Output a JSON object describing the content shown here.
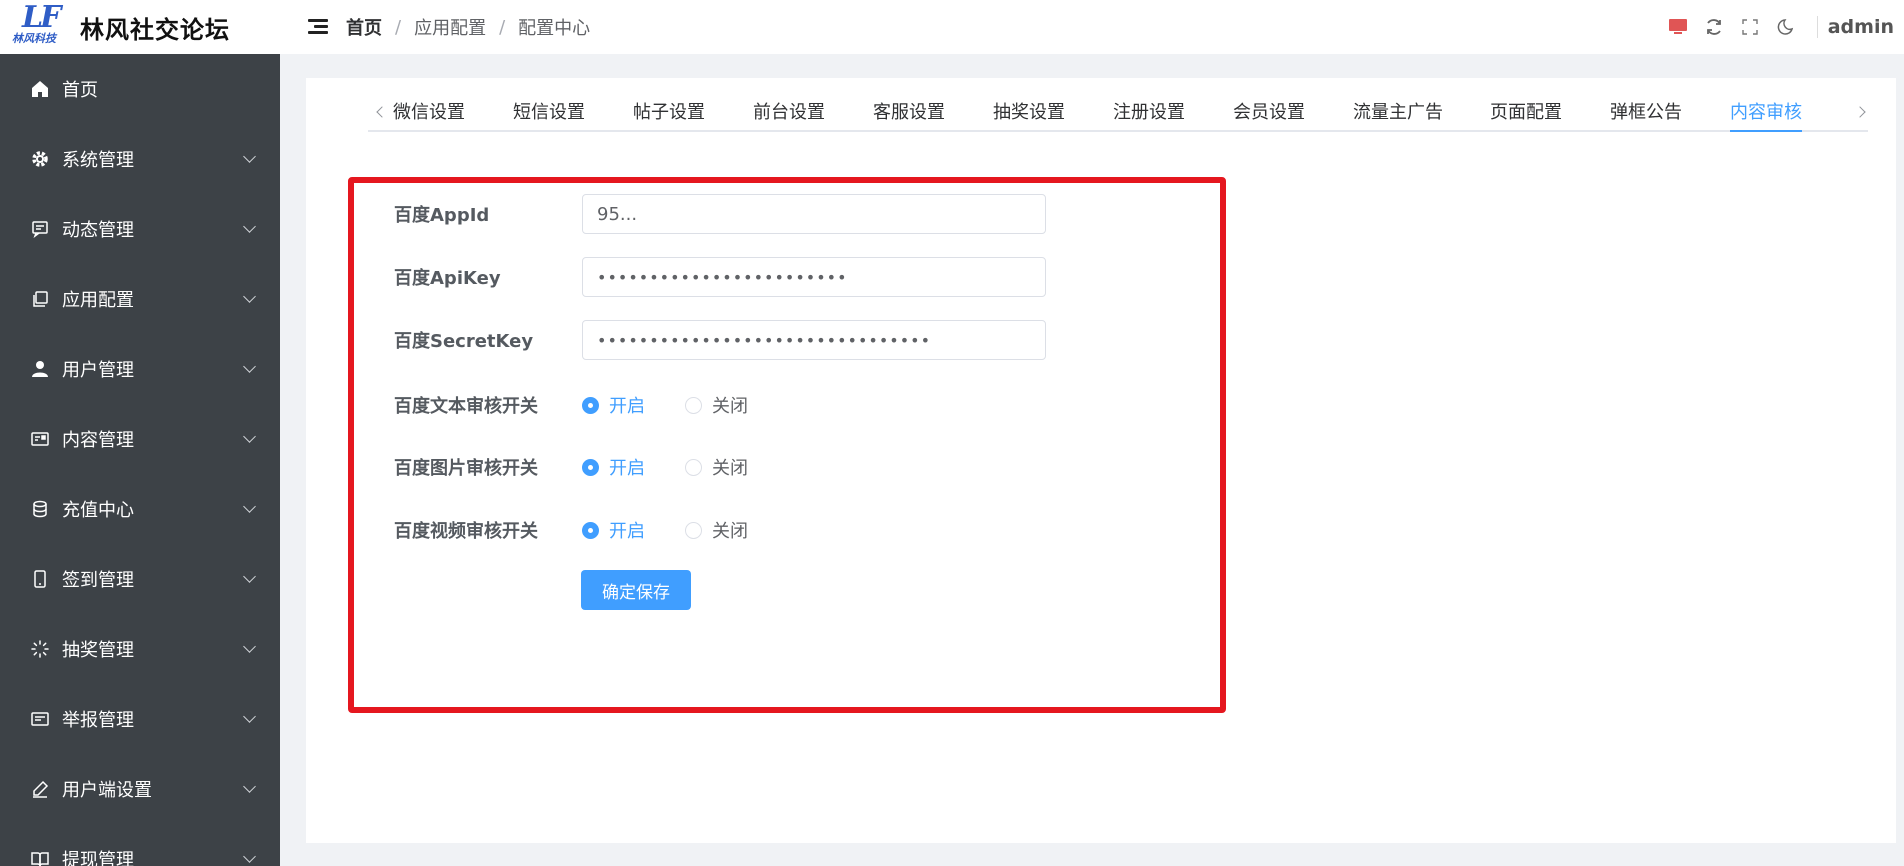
{
  "app": {
    "logo_text": "LF",
    "logo_sub": "林风科技",
    "title": "林风社交论坛"
  },
  "header": {
    "breadcrumb": [
      "首页",
      "应用配置",
      "配置中心"
    ],
    "breadcrumb_sep": "/",
    "user": "admin",
    "icons": [
      "monitor-icon",
      "refresh-icon",
      "fullscreen-icon",
      "moon-icon"
    ]
  },
  "sidebar": {
    "items": [
      {
        "label": "首页",
        "icon": "home-icon",
        "expandable": false
      },
      {
        "label": "系统管理",
        "icon": "gear-icon",
        "expandable": true
      },
      {
        "label": "动态管理",
        "icon": "message-icon",
        "expandable": true
      },
      {
        "label": "应用配置",
        "icon": "copy-icon",
        "expandable": true
      },
      {
        "label": "用户管理",
        "icon": "user-icon",
        "expandable": true
      },
      {
        "label": "内容管理",
        "icon": "postcard-icon",
        "expandable": true
      },
      {
        "label": "充值中心",
        "icon": "coin-icon",
        "expandable": true
      },
      {
        "label": "签到管理",
        "icon": "phone-icon",
        "expandable": true
      },
      {
        "label": "抽奖管理",
        "icon": "loading-icon",
        "expandable": true
      },
      {
        "label": "举报管理",
        "icon": "ticket-icon",
        "expandable": true
      },
      {
        "label": "用户端设置",
        "icon": "edit-pen-icon",
        "expandable": true
      },
      {
        "label": "提现管理",
        "icon": "notebook-icon",
        "expandable": true
      }
    ]
  },
  "tabs": {
    "items": [
      "微信设置",
      "短信设置",
      "帖子设置",
      "前台设置",
      "客服设置",
      "抽奖设置",
      "注册设置",
      "会员设置",
      "流量主广告",
      "页面配置",
      "弹框公告",
      "内容审核"
    ],
    "active_index": 11
  },
  "form": {
    "appid": {
      "label": "百度AppId",
      "value": "95..."
    },
    "apikey": {
      "label": "百度ApiKey",
      "value": "••••••••••••••••••••••••"
    },
    "secretkey": {
      "label": "百度SecretKey",
      "value": "••••••••••••••••••••••••••••••••"
    },
    "switches": [
      {
        "label": "百度文本审核开关",
        "on": "开启",
        "off": "关闭",
        "selected": "on"
      },
      {
        "label": "百度图片审核开关",
        "on": "开启",
        "off": "关闭",
        "selected": "on"
      },
      {
        "label": "百度视频审核开关",
        "on": "开启",
        "off": "关闭",
        "selected": "on"
      }
    ],
    "save_label": "确定保存"
  },
  "colors": {
    "accent": "#409eff",
    "sidebar_bg": "#3d4247",
    "highlight": "#e5171f"
  }
}
